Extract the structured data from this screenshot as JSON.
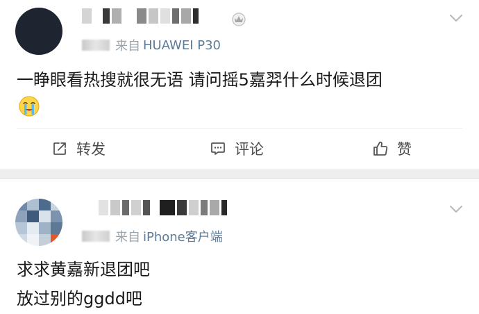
{
  "posts": [
    {
      "source_prefix": "来自",
      "device": "HUAWEI P30",
      "text_lines": [
        "一睁眼看热搜就很无语  请问摇5嘉羿什么时候退团"
      ],
      "emoji": "crying-emoji",
      "actions": {
        "repost_label": "转发",
        "comment_label": "评论",
        "like_label": "赞"
      }
    },
    {
      "source_prefix": "来自",
      "device": "iPhone客户端",
      "text_lines": [
        "求求黄嘉新退团吧",
        "放过别的ggdd吧"
      ]
    }
  ],
  "icons": {
    "repost": "repost-icon",
    "comment": "comment-icon",
    "like": "thumbs-up-icon",
    "menu": "chevron-down-icon",
    "badge": "crown-badge-icon"
  },
  "colors": {
    "link": "#5c7a96",
    "meta": "#9aa4ad",
    "separator": "#eeeeee"
  }
}
